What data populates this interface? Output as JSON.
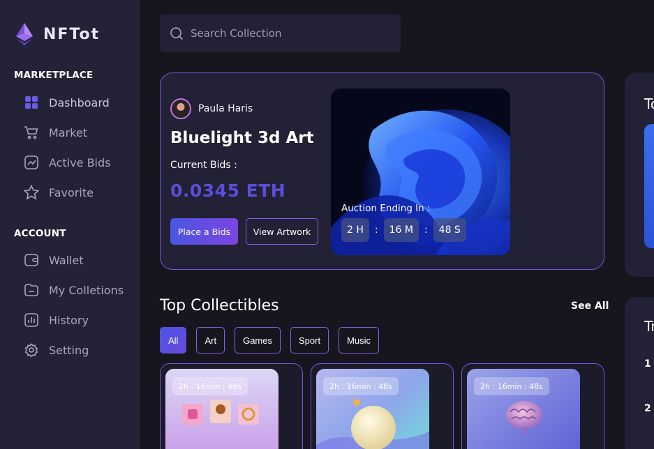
{
  "app": {
    "name": "NFTot"
  },
  "sidebar": {
    "sections": [
      {
        "title": "MARKETPLACE",
        "items": [
          {
            "label": "Dashboard",
            "icon": "grid-icon"
          },
          {
            "label": "Market",
            "icon": "cart-icon"
          },
          {
            "label": "Active Bids",
            "icon": "chart-icon"
          },
          {
            "label": "Favorite",
            "icon": "star-icon"
          }
        ]
      },
      {
        "title": "ACCOUNT",
        "items": [
          {
            "label": "Wallet",
            "icon": "wallet-icon"
          },
          {
            "label": "My Colletions",
            "icon": "folder-icon"
          },
          {
            "label": "History",
            "icon": "bar-chart-icon"
          },
          {
            "label": "Setting",
            "icon": "gear-icon"
          }
        ]
      }
    ]
  },
  "search": {
    "placeholder": "Search Collection"
  },
  "hero": {
    "creator": "Paula Haris",
    "title": "Bluelight 3d Art",
    "bids_label": "Current Bids :",
    "bids_value": "0.0345 ETH",
    "primary_button": "Place a Bids",
    "secondary_button": "View Artwork",
    "auction_label": "Auction Ending In :",
    "timer": {
      "hours": "2 H",
      "minutes": "16 M",
      "seconds": "48 S",
      "separator": ":"
    }
  },
  "right_panels": {
    "top_title": "To",
    "bottom_title": "Tr",
    "ranks": [
      "1",
      "2"
    ]
  },
  "collectibles": {
    "title": "Top Collectibles",
    "see_all": "See All",
    "filters": [
      "All",
      "Art",
      "Games",
      "Sport",
      "Music"
    ],
    "active_filter": "All",
    "cards": [
      {
        "timer": "2h : 16min : 48s"
      },
      {
        "timer": "2h : 16min : 48s"
      },
      {
        "timer": "2h : 16min : 48s"
      }
    ]
  },
  "colors": {
    "accent": "#7a55e0",
    "bid_value": "#5a4ed9",
    "sidebar_bg": "#232237",
    "page_bg": "#17161f",
    "card_bg": "#222135"
  }
}
